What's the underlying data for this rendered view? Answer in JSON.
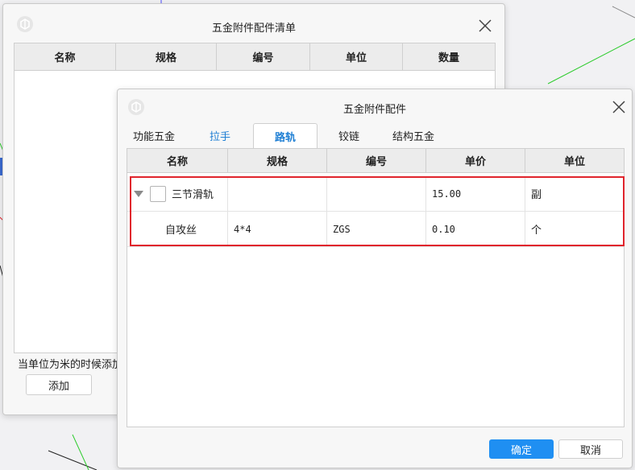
{
  "colors": {
    "accent": "#1f7fd4",
    "primary_button": "#1f8ff2",
    "highlight_border": "#e0242c"
  },
  "back_dialog": {
    "title": "五金附件配件清单",
    "columns": [
      "名称",
      "规格",
      "编号",
      "单位",
      "数量"
    ],
    "hint": "当单位为米的时候添加的",
    "add_label": "添加"
  },
  "front_dialog": {
    "title": "五金附件配件",
    "tabs": [
      {
        "label": "功能五金",
        "state": "normal"
      },
      {
        "label": "拉手",
        "state": "link"
      },
      {
        "label": "路轨",
        "state": "active"
      },
      {
        "label": "铰链",
        "state": "normal"
      },
      {
        "label": "结构五金",
        "state": "normal"
      }
    ],
    "columns": [
      "名称",
      "规格",
      "编号",
      "单价",
      "单位"
    ],
    "rows": [
      {
        "name": "三节滑轨",
        "spec": "",
        "code": "",
        "price": "15.00",
        "unit": "副"
      },
      {
        "name": "自攻丝",
        "spec": "4*4",
        "code": "ZGS",
        "price": "0.10",
        "unit": "个"
      }
    ],
    "confirm_label": "确定",
    "cancel_label": "取消"
  }
}
